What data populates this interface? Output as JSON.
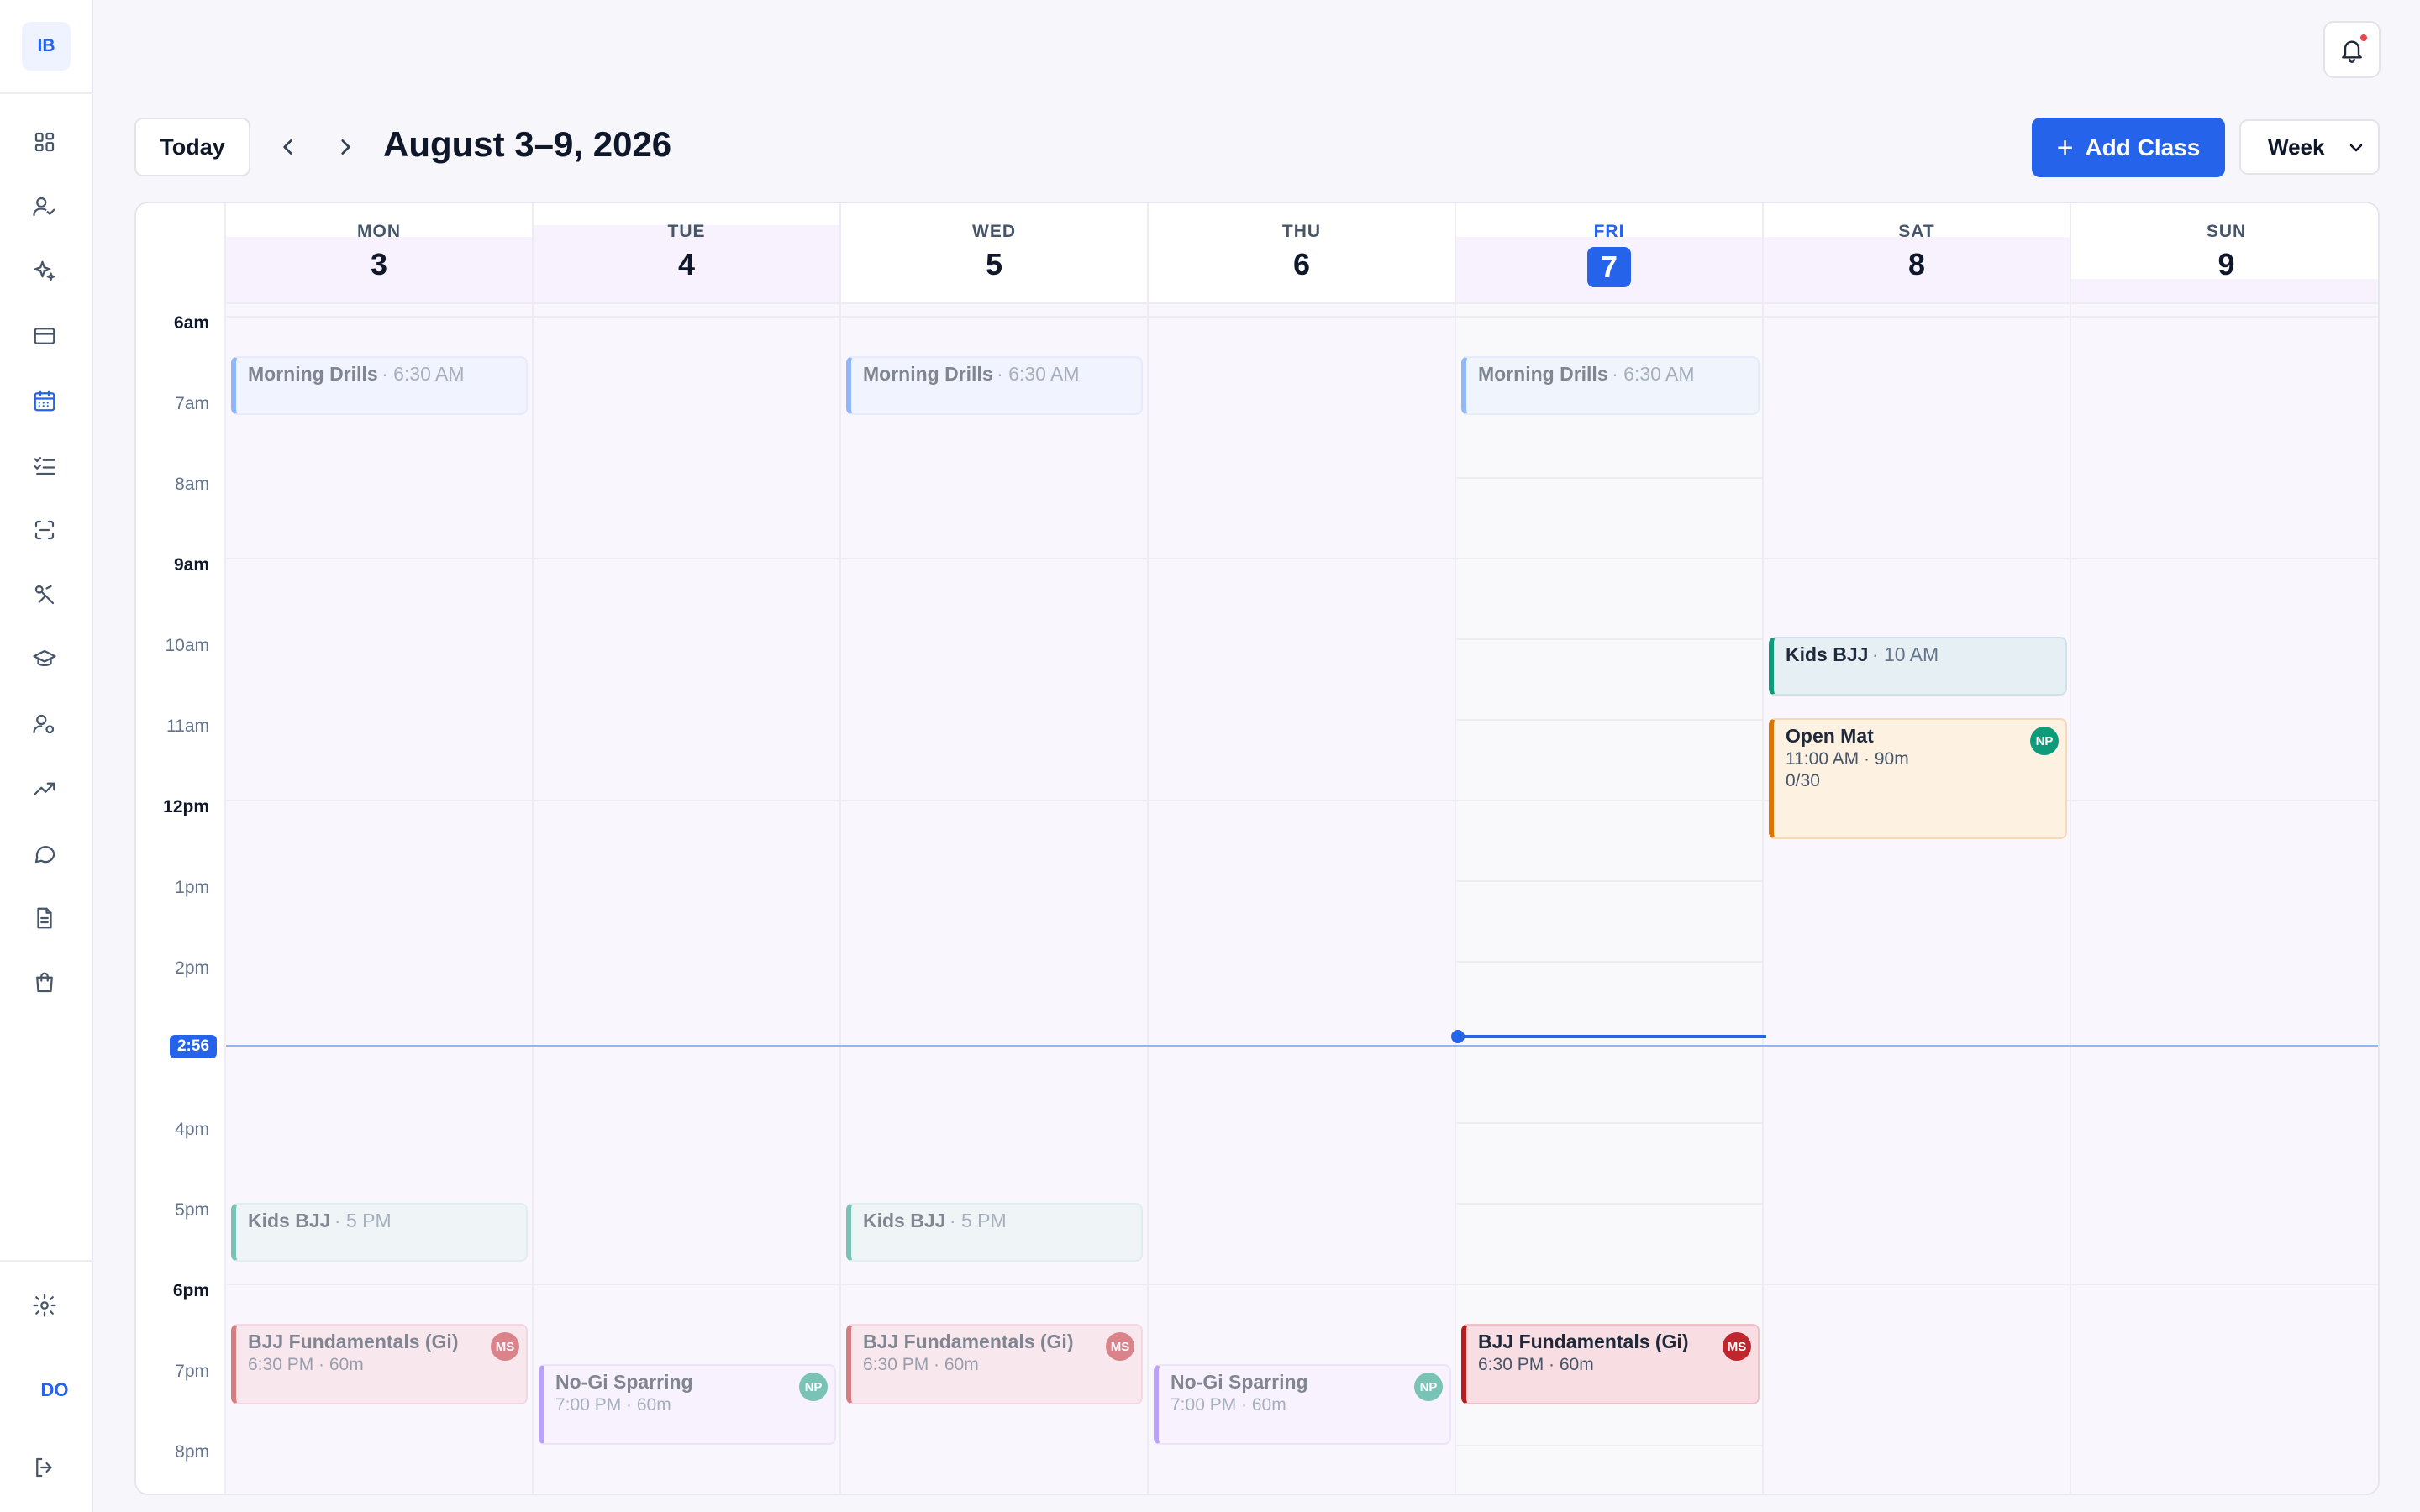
{
  "brand": {
    "initials": "IB"
  },
  "user": {
    "initials": "DO"
  },
  "toolbar": {
    "today_label": "Today",
    "range_title": "August 3–9, 2026",
    "add_label": "Add Class",
    "view_selected": "Week"
  },
  "days": [
    {
      "name": "MON",
      "num": "3"
    },
    {
      "name": "TUE",
      "num": "4"
    },
    {
      "name": "WED",
      "num": "5"
    },
    {
      "name": "THU",
      "num": "6"
    },
    {
      "name": "FRI",
      "num": "7"
    },
    {
      "name": "SAT",
      "num": "8"
    },
    {
      "name": "SUN",
      "num": "9"
    }
  ],
  "time_labels": [
    "6am",
    "7am",
    "8am",
    "9am",
    "10am",
    "11am",
    "12pm",
    "1pm",
    "2pm",
    "4pm",
    "5pm",
    "6pm",
    "7pm",
    "8pm"
  ],
  "now_label": "2:56",
  "events": {
    "mon_drills": {
      "title": "Morning Drills",
      "time": "· 6:30 AM"
    },
    "wed_drills": {
      "title": "Morning Drills",
      "time": "· 6:30 AM"
    },
    "fri_drills": {
      "title": "Morning Drills",
      "time": "· 6:30 AM"
    },
    "sat_kids": {
      "title": "Kids BJJ",
      "time": "· 10 AM"
    },
    "sat_openmat": {
      "title": "Open Mat",
      "sub": "11:00 AM · 90m",
      "capacity": "0/30",
      "badge": "NP"
    },
    "mon_kids": {
      "title": "Kids BJJ",
      "time": "· 5 PM"
    },
    "wed_kids": {
      "title": "Kids BJJ",
      "time": "· 5 PM"
    },
    "mon_fund": {
      "title": "BJJ Fundamentals (Gi)",
      "sub": "6:30 PM · 60m",
      "badge": "MS"
    },
    "wed_fund": {
      "title": "BJJ Fundamentals (Gi)",
      "sub": "6:30 PM · 60m",
      "badge": "MS"
    },
    "fri_fund": {
      "title": "BJJ Fundamentals (Gi)",
      "sub": "6:30 PM · 60m",
      "badge": "MS"
    },
    "tue_nogi": {
      "title": "No-Gi Sparring",
      "sub": "7:00 PM · 60m",
      "badge": "NP"
    },
    "thu_nogi": {
      "title": "No-Gi Sparring",
      "sub": "7:00 PM · 60m",
      "badge": "NP"
    }
  },
  "icons": {
    "nav": [
      "dashboard-icon",
      "members-icon",
      "sparkles-icon",
      "billing-icon",
      "calendar-icon",
      "tasks-icon",
      "scan-icon",
      "techniques-icon",
      "belt-icon",
      "staff-icon",
      "analytics-icon",
      "messages-icon",
      "documents-icon",
      "shop-icon",
      "settings-icon",
      "logout-icon"
    ],
    "top": [
      "bell-icon",
      "chevron-left-icon",
      "chevron-right-icon",
      "plus-icon",
      "chevron-down-icon"
    ]
  },
  "colors": {
    "accent": "#2563eb",
    "notification": "#ef4444"
  }
}
